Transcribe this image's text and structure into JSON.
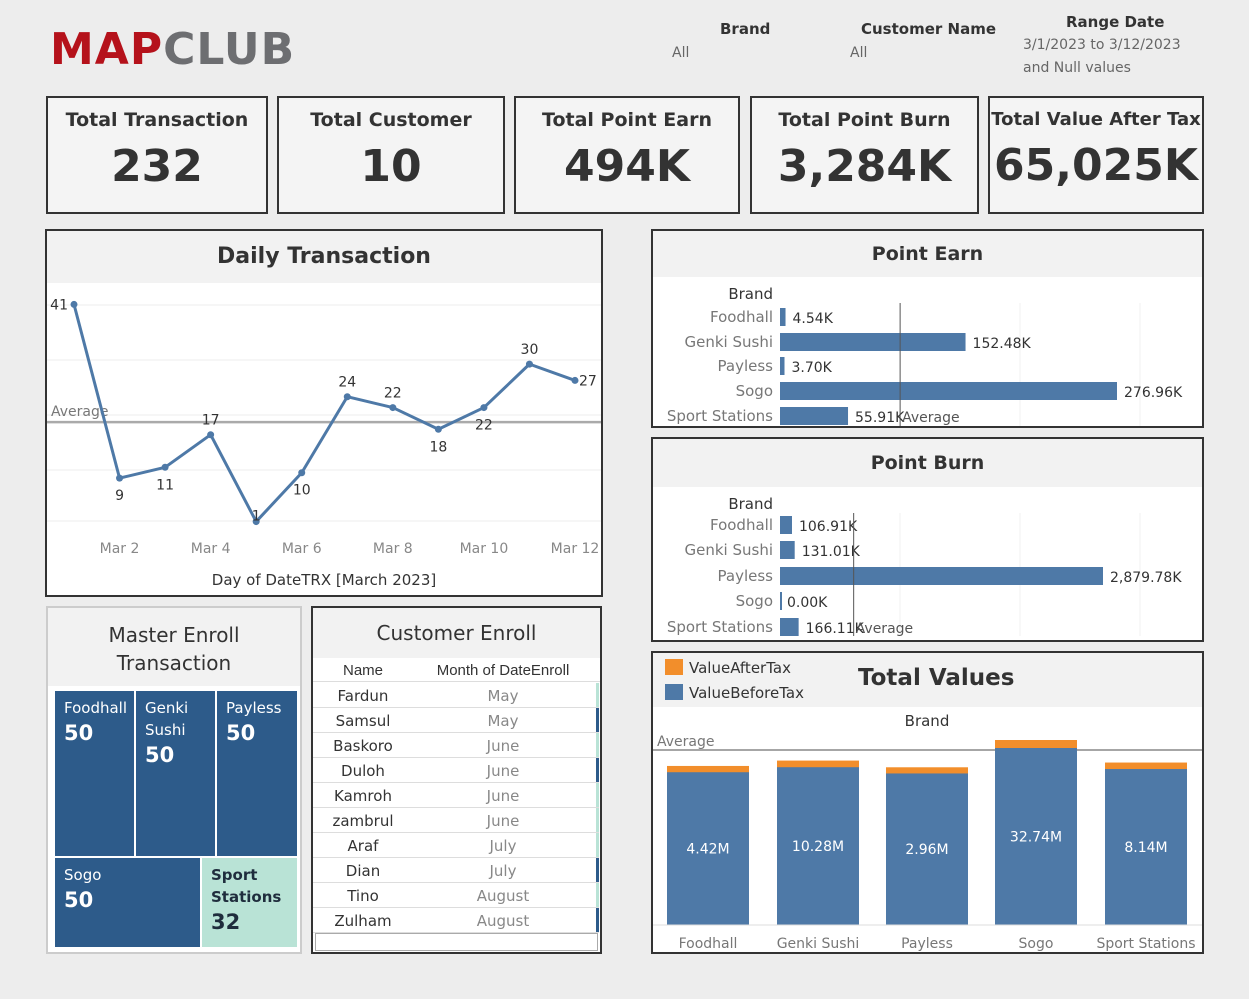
{
  "header": {
    "logo_part1": "MAP",
    "logo_part2": "CLUB",
    "filters": [
      {
        "title": "Brand",
        "value": "All"
      },
      {
        "title": "Customer Name",
        "value": "All"
      },
      {
        "title": "Range Date",
        "value_line1": "3/1/2023 to 3/12/2023",
        "value_line2": "and Null values"
      }
    ]
  },
  "kpis": [
    {
      "title": "Total Transaction",
      "value": "232"
    },
    {
      "title": "Total Customer",
      "value": "10"
    },
    {
      "title": "Total Point Earn",
      "value": "494K"
    },
    {
      "title": "Total Point Burn",
      "value": "3,284K"
    },
    {
      "title": "Total Value After Tax",
      "value": "65,025K"
    }
  ],
  "colors": {
    "primary_blue": "#4e79a7",
    "orange": "#f28e2b",
    "treemap_dark": "#2d5b8a",
    "treemap_light": "#b9e3d6",
    "brand_red": "#b5121b",
    "brand_gray": "#6d6e71"
  },
  "chart_data": [
    {
      "id": "daily",
      "type": "line",
      "title": "Daily Transaction",
      "xlabel": "Day of DateTRX [March 2023]",
      "x": [
        1,
        2,
        3,
        4,
        5,
        6,
        7,
        8,
        9,
        10,
        11,
        12
      ],
      "values": [
        41,
        9,
        11,
        17,
        1,
        10,
        24,
        22,
        18,
        22,
        30,
        27
      ],
      "data_labels": [
        "41",
        "9",
        "11",
        "17",
        "1",
        "10",
        "24",
        "22",
        "18",
        "22",
        "30",
        "27"
      ],
      "tick_labels": [
        "Mar 2",
        "Mar 4",
        "Mar 6",
        "Mar 8",
        "Mar 10",
        "Mar 12"
      ],
      "tick_x": [
        2,
        4,
        6,
        8,
        10,
        12
      ],
      "average": 19.33,
      "average_label": "Average",
      "ylim": [
        0,
        42
      ],
      "grid": true
    },
    {
      "id": "earn",
      "type": "bar",
      "title": "Point Earn",
      "header": "Brand",
      "categories": [
        "Foodhall",
        "Genki Sushi",
        "Payless",
        "Sogo",
        "Sport Stations"
      ],
      "values": [
        4.54,
        152.48,
        3.7,
        276.96,
        55.91
      ],
      "value_labels": [
        "4.54K",
        "152.48K",
        "3.70K",
        "276.96K",
        "55.91K"
      ],
      "unit": "K",
      "average": 98.72,
      "average_label": "Average"
    },
    {
      "id": "burn",
      "type": "bar",
      "title": "Point Burn",
      "header": "Brand",
      "categories": [
        "Foodhall",
        "Genki Sushi",
        "Payless",
        "Sogo",
        "Sport Stations"
      ],
      "values": [
        106.91,
        131.01,
        2879.78,
        0.0,
        166.11
      ],
      "value_labels": [
        "106.91K",
        "131.01K",
        "2,879.78K",
        "0.00K",
        "166.11K"
      ],
      "unit": "K",
      "average": 656.76,
      "average_label": "Average"
    },
    {
      "id": "values",
      "type": "bar",
      "title": "Total Values",
      "header": "Brand",
      "legend": [
        "ValueAfterTax",
        "ValueBeforeTax"
      ],
      "categories": [
        "Foodhall",
        "Genki Sushi",
        "Payless",
        "Sogo",
        "Sport Stations"
      ],
      "series": [
        {
          "name": "ValueBeforeTax",
          "values": [
            4.42,
            10.28,
            2.96,
            32.74,
            8.14
          ],
          "labels": [
            "4.42M",
            "10.28M",
            "2.96M",
            "32.74M",
            "8.14M"
          ]
        },
        {
          "name": "ValueAfterTax",
          "values": [
            4.86,
            11.31,
            3.26,
            36.01,
            8.95
          ]
        }
      ],
      "average_label": "Average"
    },
    {
      "id": "treemap",
      "type": "heatmap",
      "title_line1": "Master Enroll",
      "title_line2": "Transaction",
      "categories": [
        "Foodhall",
        "Genki Sushi",
        "Payless",
        "Sogo",
        "Sport Stations"
      ],
      "values": [
        50,
        50,
        50,
        50,
        32
      ]
    },
    {
      "id": "enroll",
      "type": "table",
      "title": "Customer Enroll",
      "columns": [
        "Name",
        "Month of DateEnroll"
      ],
      "rows": [
        [
          "Fardun",
          "May"
        ],
        [
          "Samsul",
          "May"
        ],
        [
          "Baskoro",
          "June"
        ],
        [
          "Duloh",
          "June"
        ],
        [
          "Kamroh",
          "June"
        ],
        [
          "zambrul",
          "June"
        ],
        [
          "Araf",
          "July"
        ],
        [
          "Dian",
          "July"
        ],
        [
          "Tino",
          "August"
        ],
        [
          "Zulham",
          "August"
        ]
      ]
    }
  ]
}
